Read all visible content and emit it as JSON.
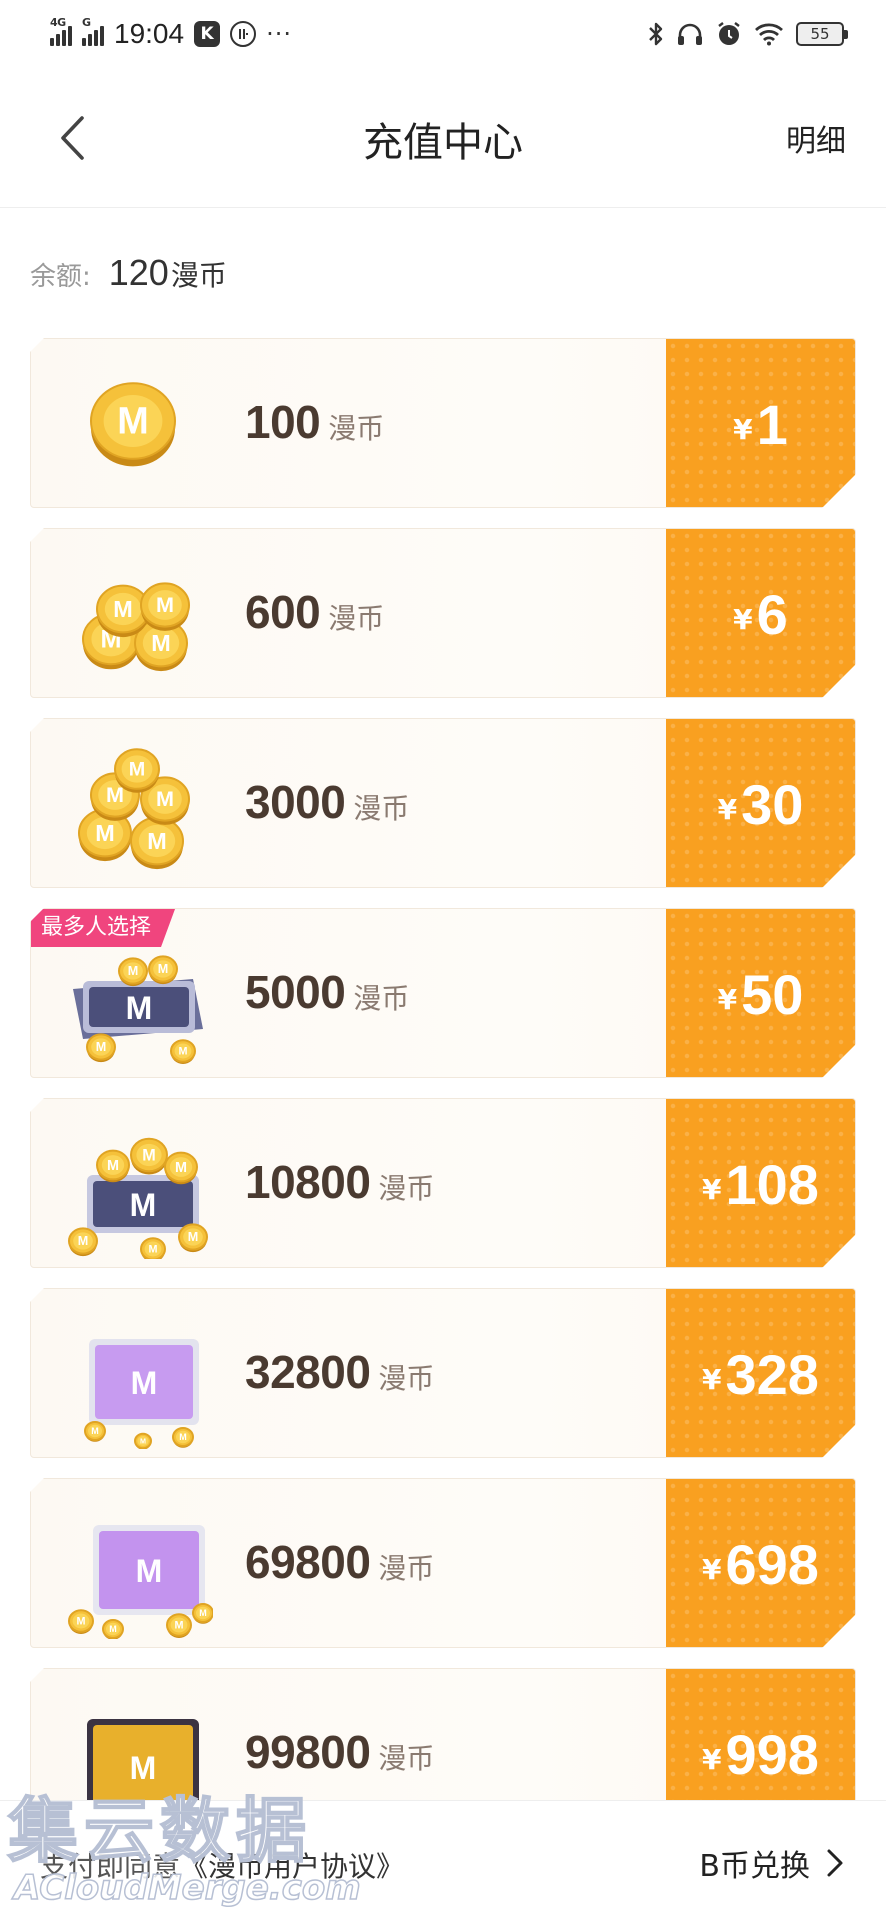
{
  "status_bar": {
    "network_1": "4G",
    "network_2": "G",
    "time": "19:04",
    "app_icon": "K",
    "circle_icon": "⑪",
    "more": "···",
    "battery": "55",
    "icons": [
      "bluetooth-icon",
      "headphones-icon",
      "alarm-icon",
      "wifi-icon"
    ]
  },
  "header": {
    "title": "充值中心",
    "detail": "明细"
  },
  "balance": {
    "label": "余额:",
    "value": "120",
    "unit": "漫币"
  },
  "packages": [
    {
      "amount": "100",
      "unit": "漫币",
      "currency": "¥",
      "price": "1",
      "icon": "single-coin-icon"
    },
    {
      "amount": "600",
      "unit": "漫币",
      "currency": "¥",
      "price": "6",
      "icon": "coin-pile-icon"
    },
    {
      "amount": "3000",
      "unit": "漫币",
      "currency": "¥",
      "price": "30",
      "icon": "coin-stack-icon"
    },
    {
      "amount": "5000",
      "unit": "漫币",
      "currency": "¥",
      "price": "50",
      "icon": "coin-tray-icon",
      "tag": "最多人选择"
    },
    {
      "amount": "10800",
      "unit": "漫币",
      "currency": "¥",
      "price": "108",
      "icon": "coin-chest-icon"
    },
    {
      "amount": "32800",
      "unit": "漫币",
      "currency": "¥",
      "price": "328",
      "icon": "purple-box-icon"
    },
    {
      "amount": "69800",
      "unit": "漫币",
      "currency": "¥",
      "price": "698",
      "icon": "purple-box-large-icon"
    },
    {
      "amount": "99800",
      "unit": "漫币",
      "currency": "¥",
      "price": "998",
      "icon": "treasure-chest-icon"
    }
  ],
  "bottom": {
    "agreement_prefix": "支付即同意",
    "agreement_link": "《漫币用户协议》",
    "exchange": "B币兑换"
  },
  "watermark": {
    "cn": "集云数据",
    "en": "ACloudMerge.com"
  },
  "colors": {
    "price_bg": "#f9a020",
    "tag_bg": "#f0457e",
    "coin_gold": "#f5c13a"
  }
}
